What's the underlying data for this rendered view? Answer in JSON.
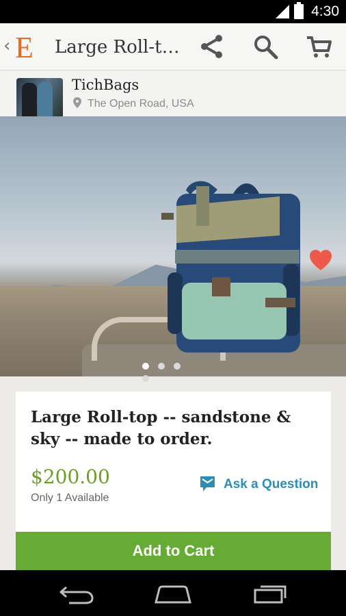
{
  "status_bar": {
    "time": "4:30"
  },
  "action_bar": {
    "back": "‹",
    "logo": "E",
    "title": "Large Roll-to..."
  },
  "shop": {
    "name": "TichBags",
    "location": "The Open Road, USA"
  },
  "product": {
    "title": "Large Roll-top -- sandstone & sky -- made to order.",
    "price": "$200.00",
    "availability": "Only 1 Available",
    "ask_label": "Ask a Question",
    "add_to_cart_label": "Add to Cart"
  },
  "carousel": {
    "slides": 4,
    "active_index": 0
  },
  "icons": [
    "signal-icon",
    "battery-icon",
    "share-icon",
    "search-icon",
    "cart-icon",
    "pin-icon",
    "favorite-heart-icon",
    "chat-icon",
    "back-nav-icon",
    "home-nav-icon",
    "recents-nav-icon"
  ],
  "colors": {
    "etsy_orange": "#e76b24",
    "price_green": "#6c9f24",
    "cart_green": "#66ac34",
    "link_blue": "#2c8eb4",
    "heart_red": "#ee5a4a"
  }
}
